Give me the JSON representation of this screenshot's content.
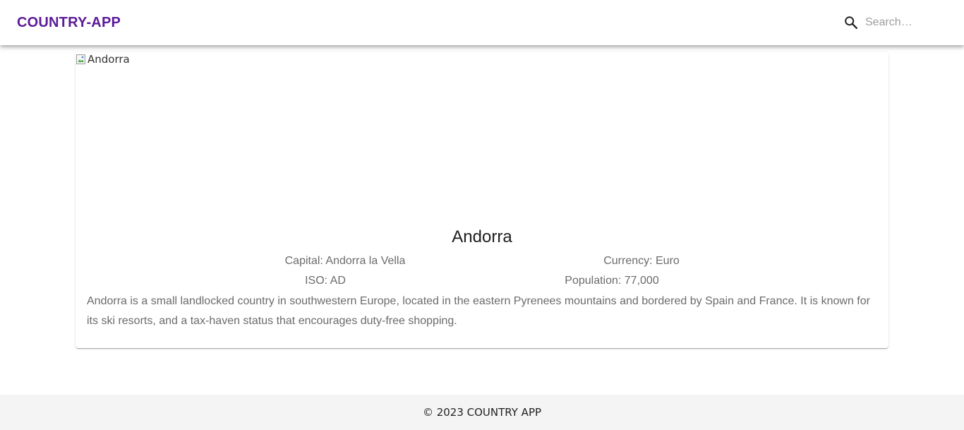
{
  "header": {
    "brand": "COUNTRY-APP",
    "search": {
      "icon": "search-icon",
      "placeholder": "Search…",
      "value": ""
    }
  },
  "country": {
    "flag_alt": "Andorra",
    "name": "Andorra",
    "capital_label": "Capital: Andorra la Vella",
    "currency_label": "Currency: Euro",
    "iso_label": "ISO: AD",
    "population_label": "Population: 77,000",
    "description": "Andorra is a small landlocked country in southwestern Europe, located in the eastern Pyrenees mountains and bordered by Spain and France. It is known for its ski resorts, and a tax-haven status that encourages duty-free shopping."
  },
  "footer": {
    "copyright": "© 2023 COUNTRY APP"
  },
  "colors": {
    "brand": "#5b1a99",
    "body_text": "#6b6b6b",
    "footer_bg": "#f4f4f4"
  }
}
